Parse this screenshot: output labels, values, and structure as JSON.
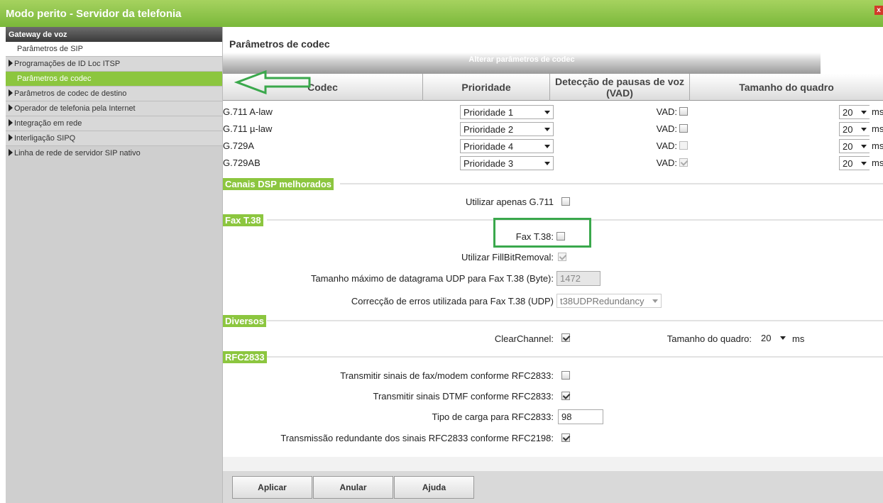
{
  "window": {
    "title": "Modo perito - Servidor da telefonia",
    "close_label": "x"
  },
  "sidebar": {
    "header": "Gateway de voz",
    "items": [
      {
        "label": "Parâmetros de SIP",
        "style": "white"
      },
      {
        "label": "Programações de ID Loc ITSP",
        "style": "gray",
        "expandable": true
      },
      {
        "label": "Parâmetros de codec",
        "style": "active"
      },
      {
        "label": "Parâmetros de codec de destino",
        "style": "gray",
        "expandable": true
      },
      {
        "label": "Operador de telefonia pela Internet",
        "style": "gray",
        "expandable": true
      },
      {
        "label": "Integração em rede",
        "style": "gray",
        "expandable": true
      },
      {
        "label": "Interligação SIPQ",
        "style": "gray",
        "expandable": true
      },
      {
        "label": "Linha de rede de servidor SIP nativo",
        "style": "plain",
        "expandable": true
      }
    ]
  },
  "main": {
    "title": "Parâmetros de codec",
    "subheader": "Alterar parâmetros de codec",
    "table": {
      "headers": [
        "Codec",
        "Prioridade",
        "Detecção de pausas de voz (VAD)",
        "Tamanho do quadro"
      ],
      "rows": [
        {
          "codec": "G.711 A-law",
          "priority": "Prioridade 1",
          "vad_label": "VAD:",
          "vad_checked": false,
          "vad_disabled": false,
          "frame": "20",
          "unit": "ms"
        },
        {
          "codec": "G.711 µ-law",
          "priority": "Prioridade 2",
          "vad_label": "VAD:",
          "vad_checked": false,
          "vad_disabled": false,
          "frame": "20",
          "unit": "ms"
        },
        {
          "codec": "G.729A",
          "priority": "Prioridade 4",
          "vad_label": "VAD:",
          "vad_checked": false,
          "vad_disabled": true,
          "frame": "20",
          "unit": "ms"
        },
        {
          "codec": "G.729AB",
          "priority": "Prioridade 3",
          "vad_label": "VAD:",
          "vad_checked": true,
          "vad_disabled": true,
          "frame": "20",
          "unit": "ms"
        }
      ]
    },
    "dsp": {
      "section": "Canais DSP melhorados",
      "only_g711_label": "Utilizar apenas G.711",
      "only_g711_checked": false
    },
    "fax": {
      "section": "Fax T.38",
      "fax_label": "Fax T.38:",
      "fax_checked": false,
      "fillbit_label": "Utilizar FillBitRemoval:",
      "fillbit_checked": true,
      "udp_size_label": "Tamanho máximo de datagrama UDP para Fax T.38 (Byte):",
      "udp_size_value": "1472",
      "error_corr_label": "Correcção de erros utilizada para Fax T.38 (UDP)",
      "error_corr_value": "t38UDPRedundancy"
    },
    "misc": {
      "section": "Diversos",
      "clearchannel_label": "ClearChannel:",
      "clearchannel_checked": true,
      "frame_label": "Tamanho do quadro:",
      "frame_value": "20",
      "frame_unit": "ms"
    },
    "rfc": {
      "section": "RFC2833",
      "fax_modem_label": "Transmitir sinais de fax/modem conforme RFC2833:",
      "fax_modem_checked": false,
      "dtmf_label": "Transmitir sinais DTMF conforme RFC2833:",
      "dtmf_checked": true,
      "payload_label": "Tipo de carga para RFC2833:",
      "payload_value": "98",
      "redundant_label": "Transmissão redundante dos sinais RFC2833 conforme RFC2198:",
      "redundant_checked": true
    },
    "buttons": {
      "apply": "Aplicar",
      "cancel": "Anular",
      "help": "Ajuda"
    }
  },
  "colors": {
    "brand_green": "#8cc63f",
    "annotation_green": "#3aa84c"
  }
}
